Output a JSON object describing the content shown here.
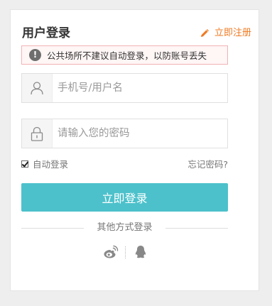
{
  "login": {
    "title": "用户登录",
    "register_label": "立即注册",
    "warning_text": "公共场所不建议自动登录，以防账号丢失",
    "username_placeholder": "手机号/用户名",
    "password_placeholder": "请输入您的密码",
    "remember_label": "自动登录",
    "remember_checked": true,
    "forgot_label": "忘记密码?",
    "submit_label": "立即登录",
    "other_login_label": "其他方式登录"
  },
  "icons": {
    "register": "pencil-icon",
    "warning": "exclamation-icon",
    "username": "user-icon",
    "password": "lock-icon",
    "social": [
      "weibo-icon",
      "qq-icon"
    ]
  },
  "colors": {
    "accent": "#4cc1cb",
    "register": "#ef7a22",
    "warning_border": "#f1b3b3",
    "warning_bg": "#fff6f6"
  }
}
